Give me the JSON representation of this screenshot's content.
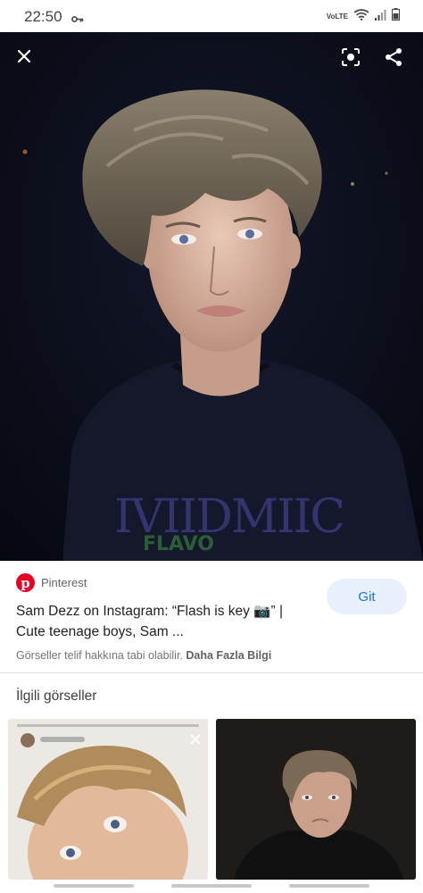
{
  "status_bar": {
    "time": "22:50",
    "network_label": "VoLTE"
  },
  "hero": {
    "close_icon": "close-icon",
    "lens_icon": "lens-icon",
    "share_icon": "share-icon"
  },
  "result": {
    "source_name": "Pinterest",
    "title": "Sam Dezz on Instagram: “Flash is key 📷” | Cute teenage boys, Sam ...",
    "go_label": "Git",
    "copyright_text": "Görseller telif hakkına tabi olabilir.",
    "more_info_label": "Daha Fazla Bilgi"
  },
  "related": {
    "title": "İlgili görseller"
  },
  "colors": {
    "accent": "#1a73e8",
    "pinterest": "#e60023",
    "hero_bg": "#0b0d1a"
  }
}
